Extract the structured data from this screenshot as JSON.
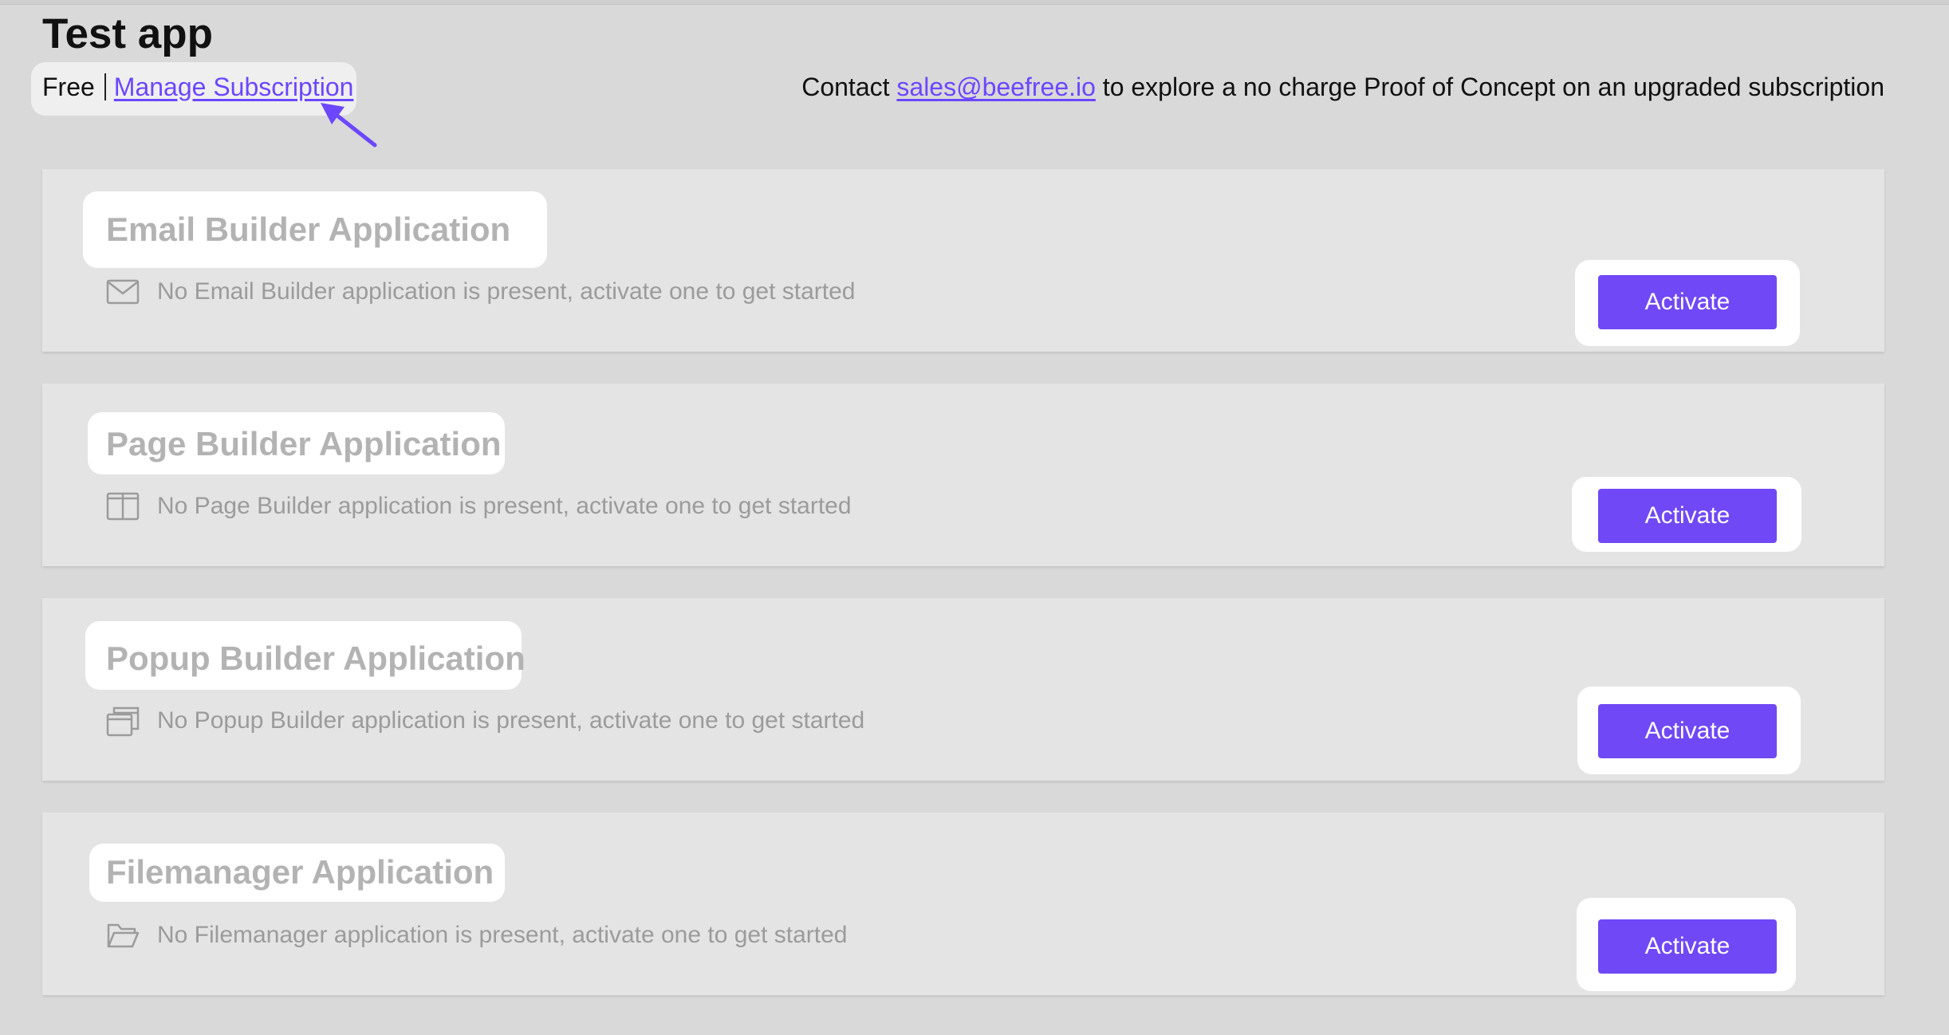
{
  "app": {
    "title": "Test app"
  },
  "plan": {
    "name": "Free",
    "manage_link": "Manage Subscription"
  },
  "contact": {
    "prefix": "Contact",
    "email": "sales@beefree.io",
    "suffix": "to explore a no charge Proof of Concept on an upgraded subscription"
  },
  "colors": {
    "accent": "#7048f5",
    "link": "#6c47ff",
    "background": "#d9d9d9",
    "card": "#e4e4e4"
  },
  "applications": [
    {
      "title": "Email Builder Application",
      "message": "No Email Builder application is present, activate one to get started",
      "icon": "envelope-icon",
      "button": "Activate"
    },
    {
      "title": "Page Builder Application",
      "message": "No Page Builder application is present, activate one to get started",
      "icon": "page-layout-icon",
      "button": "Activate"
    },
    {
      "title": "Popup Builder Application",
      "message": "No Popup Builder application is present, activate one to get started",
      "icon": "popup-windows-icon",
      "button": "Activate"
    },
    {
      "title": "Filemanager Application",
      "message": "No Filemanager application is present, activate one to get started",
      "icon": "folder-icon",
      "button": "Activate"
    }
  ]
}
